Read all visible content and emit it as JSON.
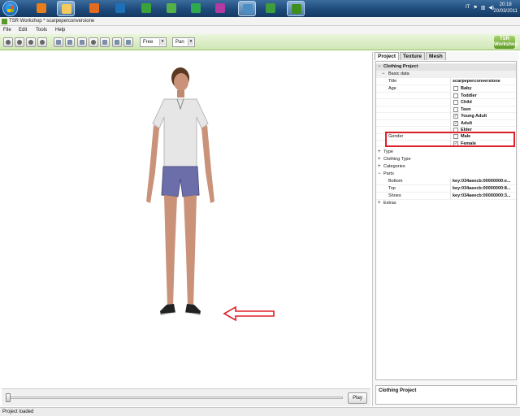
{
  "taskbar": {
    "language": "IT",
    "time": "20:18",
    "date": "20/03/2011",
    "apps": [
      {
        "icon": "media-player-icon",
        "color": "#e87d1b"
      },
      {
        "icon": "explorer-folder-icon",
        "color": "#f4c95d"
      },
      {
        "icon": "firefox-icon",
        "color": "#e36a1e"
      },
      {
        "icon": "photoshop-icon",
        "color": "#1d6fb8"
      },
      {
        "icon": "green-app-icon",
        "color": "#3aa43a"
      },
      {
        "icon": "green-app-icon-2",
        "color": "#56b04a"
      },
      {
        "icon": "sims-icon",
        "color": "#2fa84f"
      },
      {
        "icon": "purple-app-icon",
        "color": "#b23aa0"
      },
      {
        "icon": "circle-app-icon",
        "color": "#4d8fc4"
      },
      {
        "icon": "users-app-icon",
        "color": "#3e9c3e"
      },
      {
        "icon": "tsr-workshop-icon",
        "color": "#3f8f1e"
      }
    ]
  },
  "window": {
    "title": "TSR Workshop * scarpeperconversione"
  },
  "menu": {
    "file": "File",
    "edit": "Edit",
    "tools": "Tools",
    "help": "Help"
  },
  "toolbar": {
    "camera_mode": "Free",
    "nav_mode": "Pan",
    "logo_line1": "TSR",
    "logo_line2": "Workshop"
  },
  "tabs": [
    "Project",
    "Texture",
    "Mesh"
  ],
  "properties": {
    "root": "Clothing Project",
    "basic_data": "Basic data",
    "title_label": "Title",
    "title_value": "scarpeperconversione",
    "age_label": "Age",
    "ages": [
      {
        "label": "Baby",
        "checked": false
      },
      {
        "label": "Toddler",
        "checked": false
      },
      {
        "label": "Child",
        "checked": false
      },
      {
        "label": "Teen",
        "checked": false
      },
      {
        "label": "Young Adult",
        "checked": true
      },
      {
        "label": "Adult",
        "checked": true
      },
      {
        "label": "Elder",
        "checked": false
      }
    ],
    "gender_label": "Gender",
    "genders": [
      {
        "label": "Male",
        "checked": false
      },
      {
        "label": "Female",
        "checked": true
      }
    ],
    "type": "Type",
    "clothing_type": "Clothing Type",
    "categories": "Categories",
    "parts": "Parts",
    "bottom_label": "Bottom",
    "bottom_value": "key:034aeecb:00000000:e...",
    "top_label": "Top",
    "top_value": "key:034aeecb:00000000:8...",
    "shoes_label": "Shoes",
    "shoes_value": "key:034aeecb:00000000:3...",
    "extras": "Extras"
  },
  "description": "Clothing Project",
  "timeline": {
    "play_label": "Play",
    "position": 0
  },
  "status": "Project loaded",
  "colors": {
    "toolbar_green": "#cfe6b4",
    "highlight_red": "#e0202a",
    "annotation_arrow": "#e0202a"
  }
}
